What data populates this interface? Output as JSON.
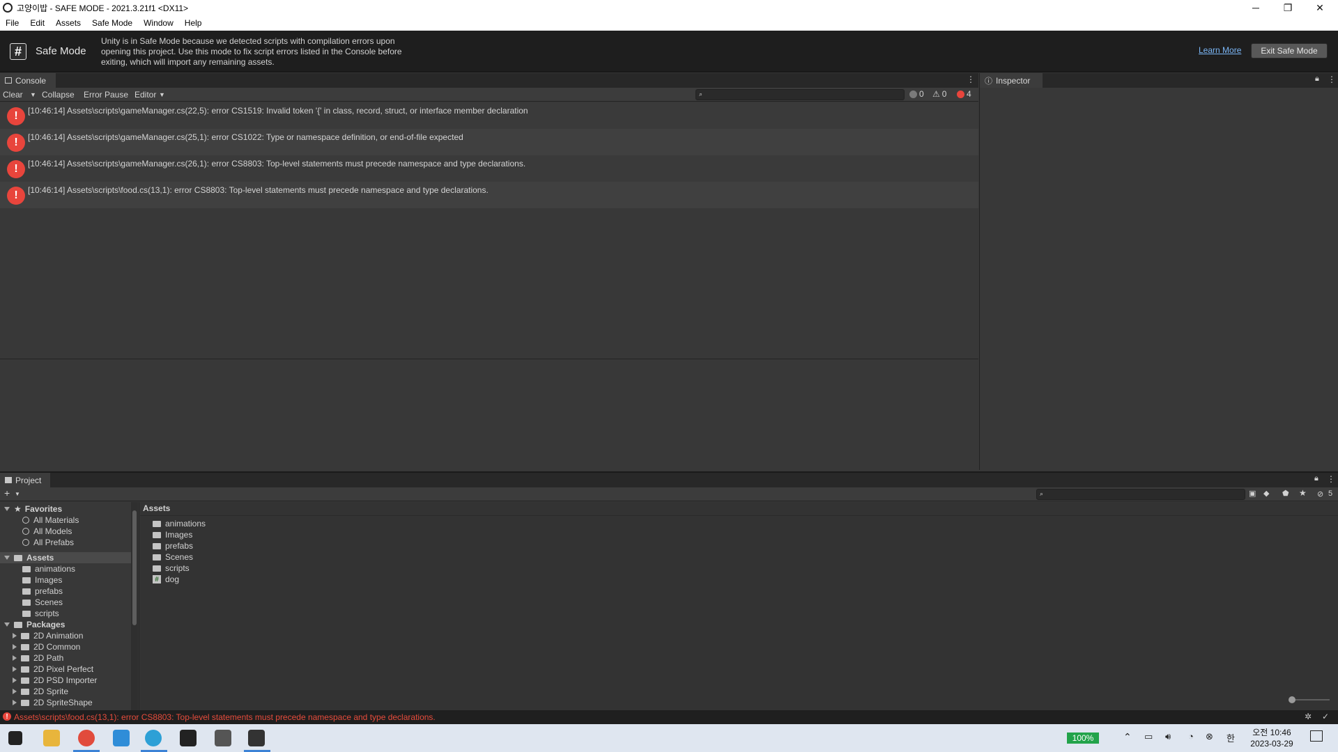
{
  "window": {
    "title": "고양이밥 - SAFE MODE - 2021.3.21f1 <DX11>",
    "minimize": "─",
    "restore": "❐",
    "close": "✕"
  },
  "menu": [
    "File",
    "Edit",
    "Assets",
    "Safe Mode",
    "Window",
    "Help"
  ],
  "banner": {
    "title": "Safe Mode",
    "description": "Unity is in Safe Mode because we detected scripts with compilation errors upon opening this project. Use this mode to fix script errors listed in the Console before exiting, which will import any remaining assets.",
    "learn_more": "Learn More",
    "exit_button": "Exit Safe Mode"
  },
  "console": {
    "tab": "Console",
    "toolbar": {
      "clear": "Clear",
      "collapse": "Collapse",
      "error_pause": "Error Pause",
      "editor": "Editor"
    },
    "counts": {
      "log": "0",
      "warning": "0",
      "error": "4"
    },
    "messages": [
      "[10:46:14] Assets\\scripts\\gameManager.cs(22,5): error CS1519: Invalid token '{' in class, record, struct, or interface member declaration",
      "[10:46:14] Assets\\scripts\\gameManager.cs(25,1): error CS1022: Type or namespace definition, or end-of-file expected",
      "[10:46:14] Assets\\scripts\\gameManager.cs(26,1): error CS8803: Top-level statements must precede namespace and type declarations.",
      "[10:46:14] Assets\\scripts\\food.cs(13,1): error CS8803: Top-level statements must precede namespace and type declarations."
    ]
  },
  "inspector": {
    "tab": "Inspector"
  },
  "project": {
    "tab": "Project",
    "hidden_count": "5",
    "tree": {
      "favorites": "Favorites",
      "favorite_items": [
        "All Materials",
        "All Models",
        "All Prefabs"
      ],
      "assets": "Assets",
      "asset_folders": [
        "animations",
        "Images",
        "prefabs",
        "Scenes",
        "scripts"
      ],
      "packages": "Packages",
      "package_items": [
        "2D Animation",
        "2D Common",
        "2D Path",
        "2D Pixel Perfect",
        "2D PSD Importer",
        "2D Sprite",
        "2D SpriteShape"
      ]
    },
    "breadcrumb": "Assets",
    "assets_list": [
      "animations",
      "Images",
      "prefabs",
      "Scenes",
      "scripts",
      "dog"
    ]
  },
  "status": {
    "message": "Assets\\scripts\\food.cs(13,1): error CS8803: Top-level statements must precede namespace and type declarations."
  },
  "taskbar": {
    "battery": "100%",
    "time": "오전 10:46",
    "date": "2023-03-29",
    "ime": "한"
  }
}
